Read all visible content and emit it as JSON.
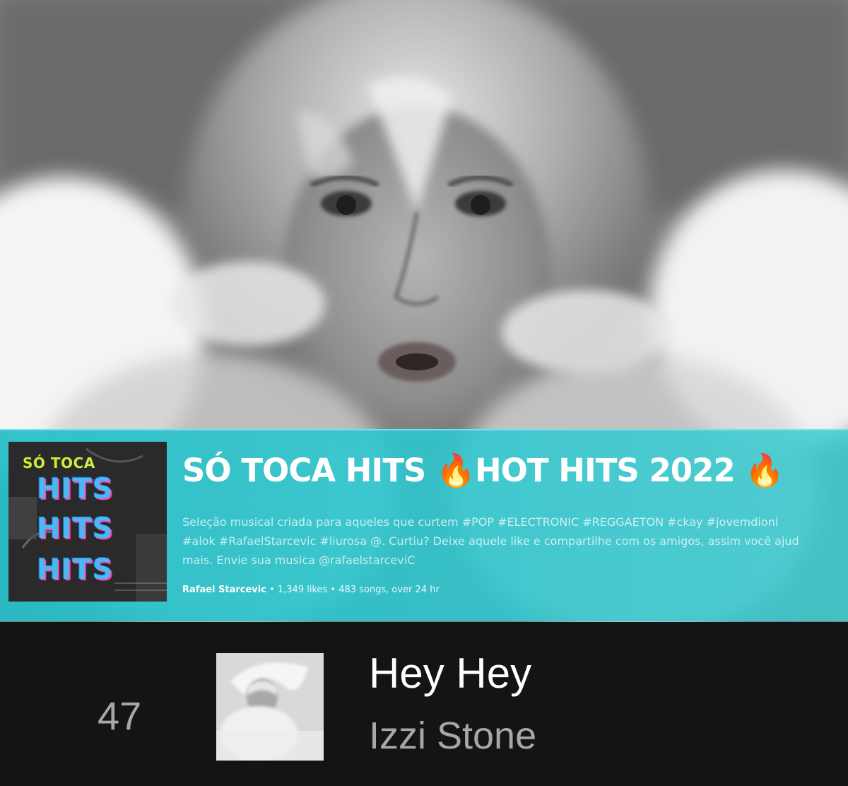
{
  "playlist": {
    "title": "SÓ TOCA HITS 🔥HOT HITS 2022 🔥",
    "cover": {
      "top_text": "SÓ TOCA",
      "hits_word": "HITS"
    },
    "description_lines": [
      "Seleção musical criada para aqueles que curtem #POP #ELECTRONIC #REGGAETON #ckay #jovemdioni",
      "#alok #RafaelStarcevic #liurosa @. Curtiu? Deixe aquele like e compartilhe com os amigos, assim você ajud",
      "mais. Envie sua musica @rafaelstarceviC"
    ],
    "owner": "Rafael Starcevic",
    "stats": " • 1,349 likes • 483 songs, over 24 hr"
  },
  "track": {
    "number": "47",
    "title": "Hey Hey",
    "artist": "Izzi Stone"
  },
  "colors": {
    "banner": "#2fc3cc",
    "background": "#121212",
    "muted_text": "#a7a7a7",
    "accent_yellow": "#c9ef3a",
    "accent_blue": "#49b9f2",
    "accent_pink": "#ff3fb4"
  }
}
